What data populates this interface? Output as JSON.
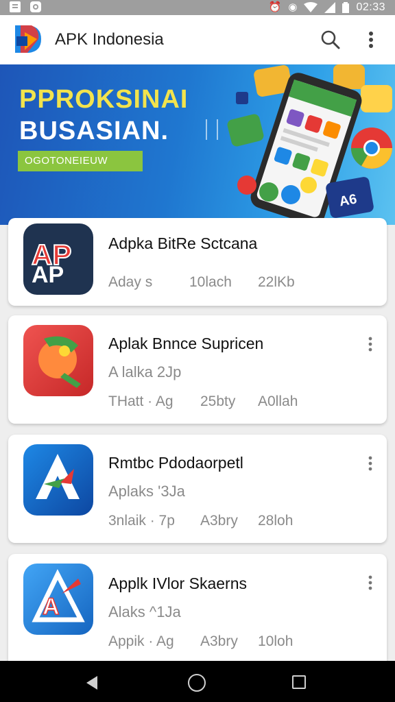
{
  "status_bar": {
    "time": "02:33",
    "icons": [
      "document-icon",
      "notification-icon",
      "alarm-icon",
      "clock-icon",
      "wifi-icon",
      "signal-icon",
      "battery-icon"
    ]
  },
  "app_bar": {
    "title": "APK Indonesia",
    "icons": [
      "app-logo",
      "search-icon",
      "more-vert-icon"
    ]
  },
  "banner": {
    "line1": "PPROKSINAI",
    "line2": "BUSASIAN.",
    "cta": "OGOTONEIEUW"
  },
  "apps": [
    {
      "name": "Adpka BitRe Sctcana",
      "subtitle": "",
      "meta": [
        "Aday s",
        "10lach",
        "22lKb"
      ],
      "icon_text": "AP",
      "icon_colors": [
        "#1f3350",
        "#e53935"
      ]
    },
    {
      "name": "Aplak Bnnce Supricen",
      "subtitle": "A lalka 2Jp",
      "meta": [
        "THatt · Ag",
        "25bty",
        "A0llah"
      ],
      "icon_text": "",
      "icon_colors": [
        "#e53935",
        "#ff8a3d"
      ]
    },
    {
      "name": "Rmtbc Pdodaorpetl",
      "subtitle": "Aplaks '3Ja",
      "meta": [
        "3nlaik · 7p",
        "A3bry",
        "28loh"
      ],
      "icon_text": "",
      "icon_colors": [
        "#1f6fd6",
        "#0d47a1"
      ]
    },
    {
      "name": "Applk IVlor Skaerns",
      "subtitle": "Alaks ^1Ja",
      "meta": [
        "Appik · Ag",
        "A3bry",
        "10loh"
      ],
      "icon_text": "A",
      "icon_colors": [
        "#1e88e5",
        "#42a5f5"
      ]
    }
  ],
  "nav": {
    "icons": [
      "back-icon",
      "home-icon",
      "recents-icon"
    ]
  }
}
